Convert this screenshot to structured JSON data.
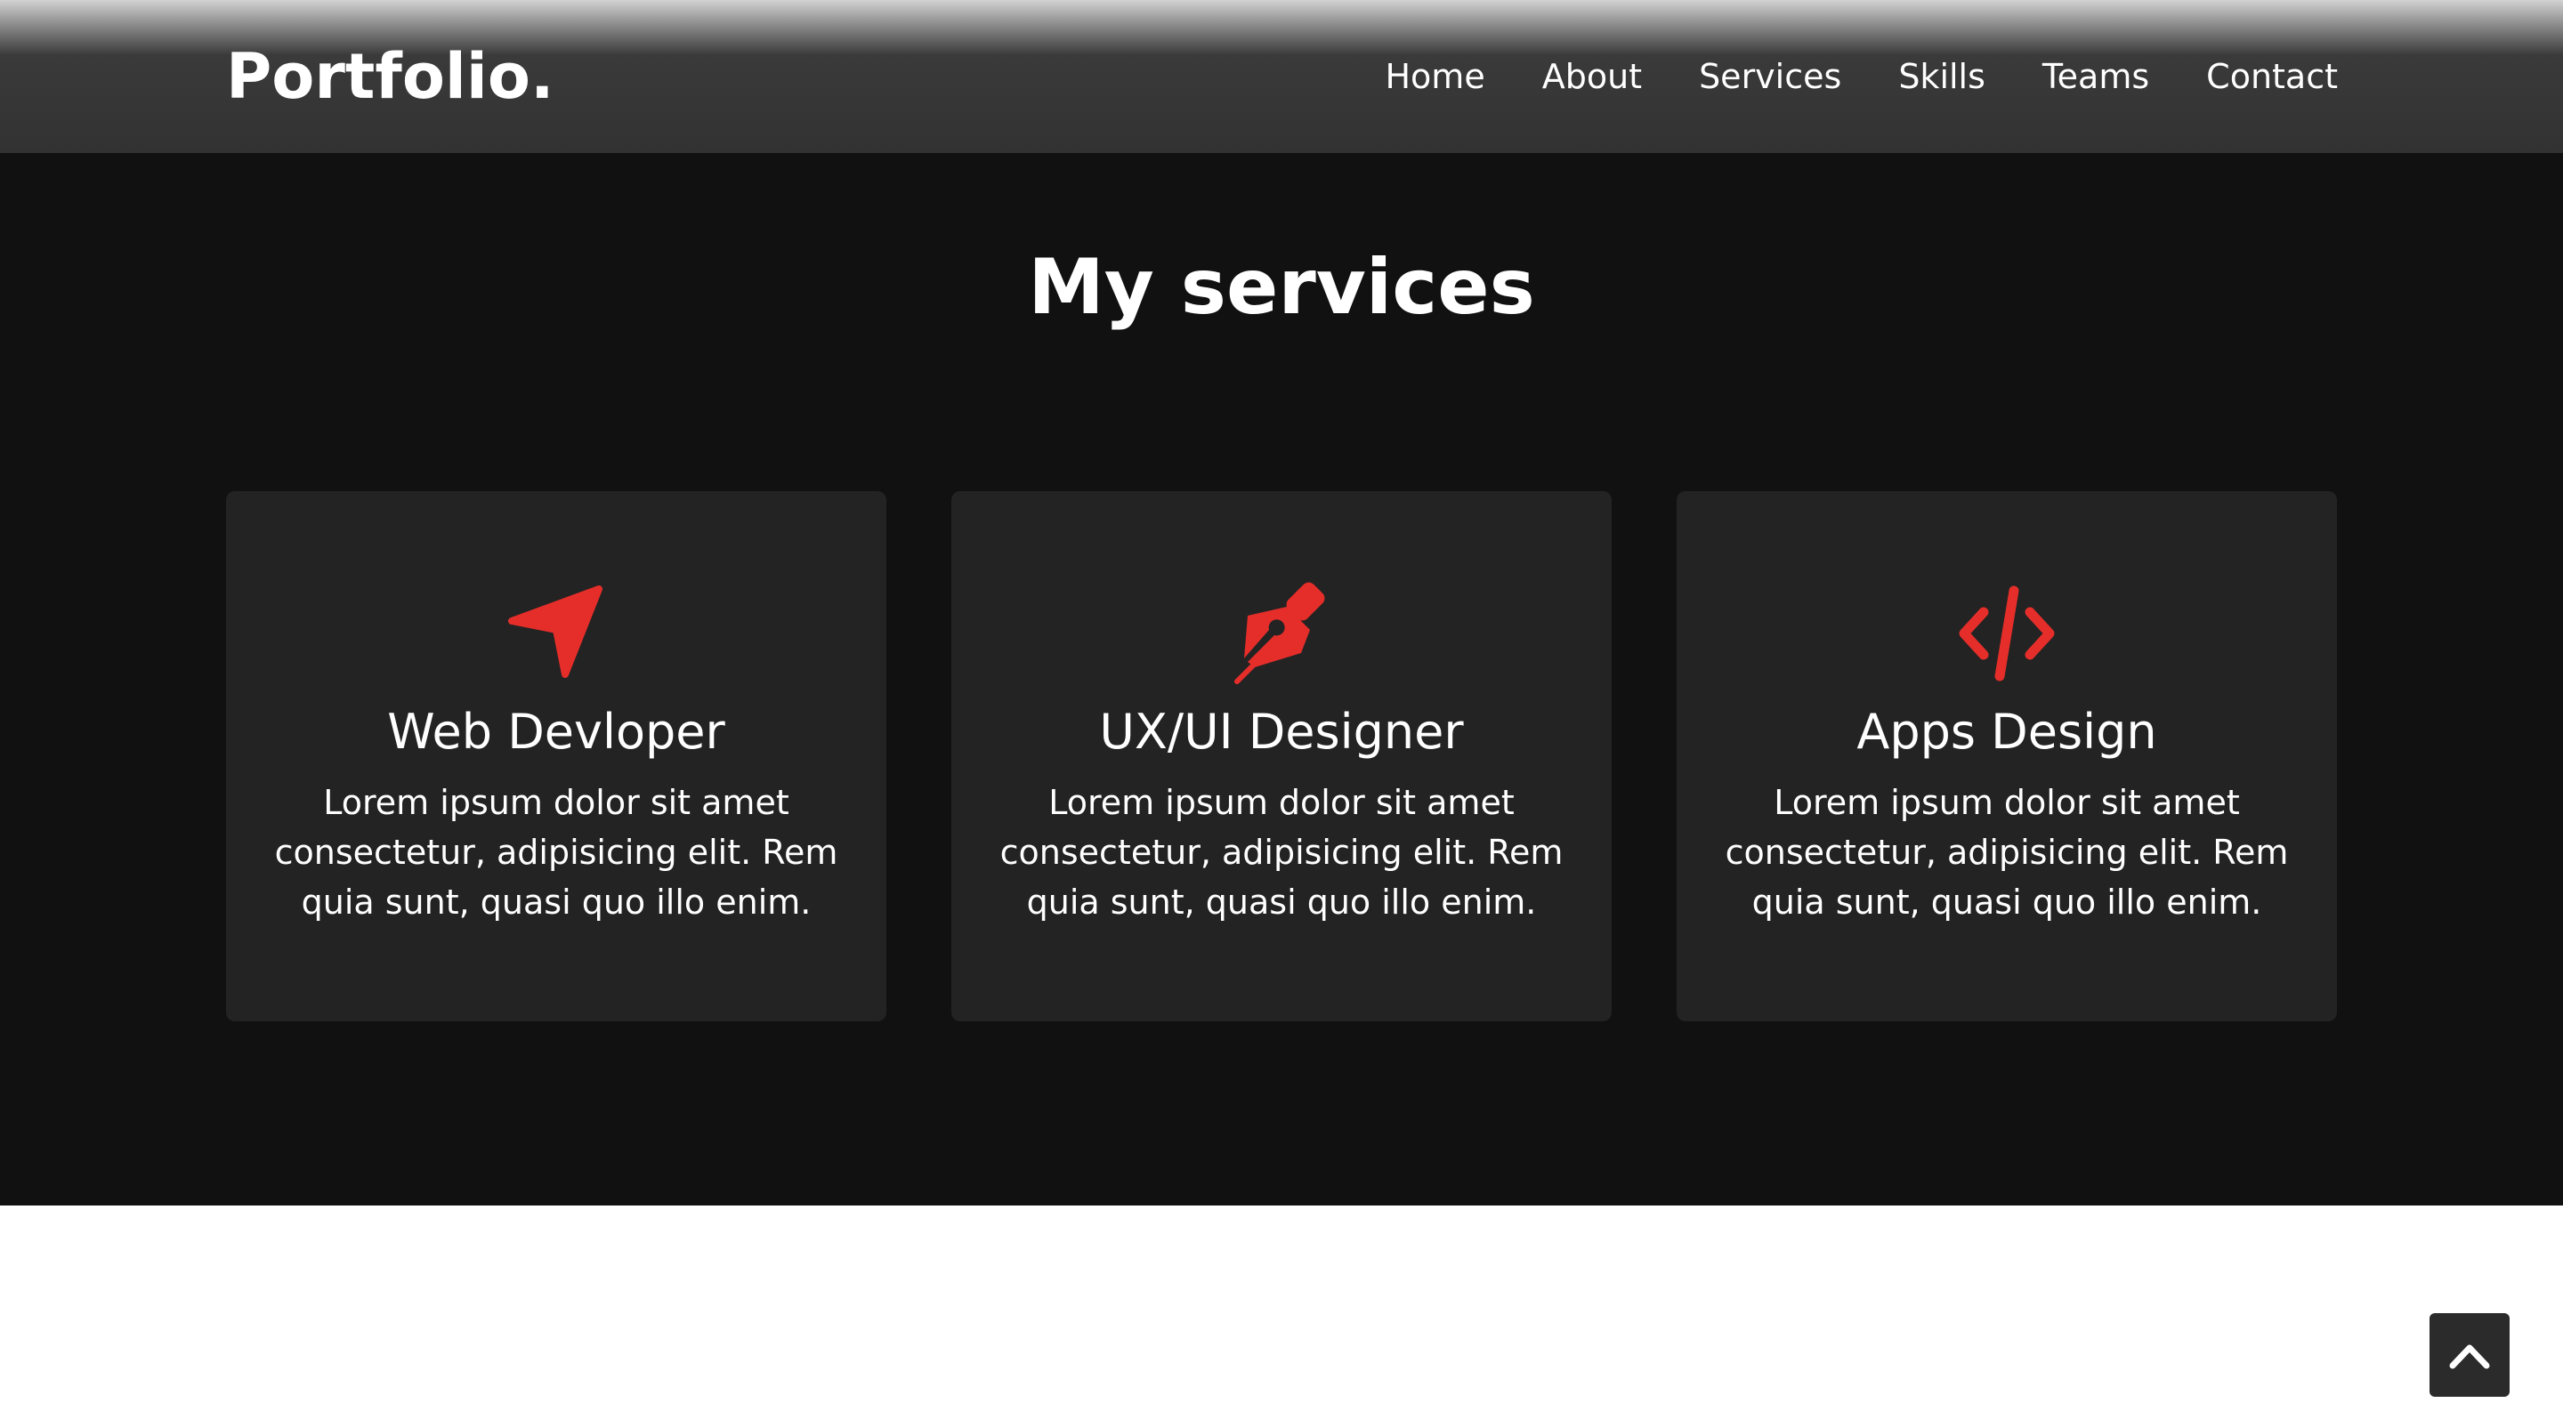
{
  "brand": {
    "logo": "Portfolio."
  },
  "nav": {
    "links": [
      {
        "label": "Home"
      },
      {
        "label": "About"
      },
      {
        "label": "Services"
      },
      {
        "label": "Skills"
      },
      {
        "label": "Teams"
      },
      {
        "label": "Contact"
      }
    ]
  },
  "services": {
    "title": "My services",
    "cards": [
      {
        "icon": "location-arrow-icon",
        "title": "Web Devloper",
        "text": "Lorem ipsum dolor sit amet consectetur, adipisicing elit. Rem quia sunt, quasi quo illo enim."
      },
      {
        "icon": "pen-nib-icon",
        "title": "UX/UI Designer",
        "text": "Lorem ipsum dolor sit amet consectetur, adipisicing elit. Rem quia sunt, quasi quo illo enim."
      },
      {
        "icon": "code-icon",
        "title": "Apps Design",
        "text": "Lorem ipsum dolor sit amet consectetur, adipisicing elit. Rem quia sunt, quasi quo illo enim."
      }
    ]
  },
  "back_to_top": {
    "icon": "chevron-up-icon"
  },
  "colors": {
    "accent": "#e52e2a",
    "navbar": "#323232",
    "section_bg": "#111111",
    "card_bg": "#232323",
    "text": "#ffffff"
  }
}
